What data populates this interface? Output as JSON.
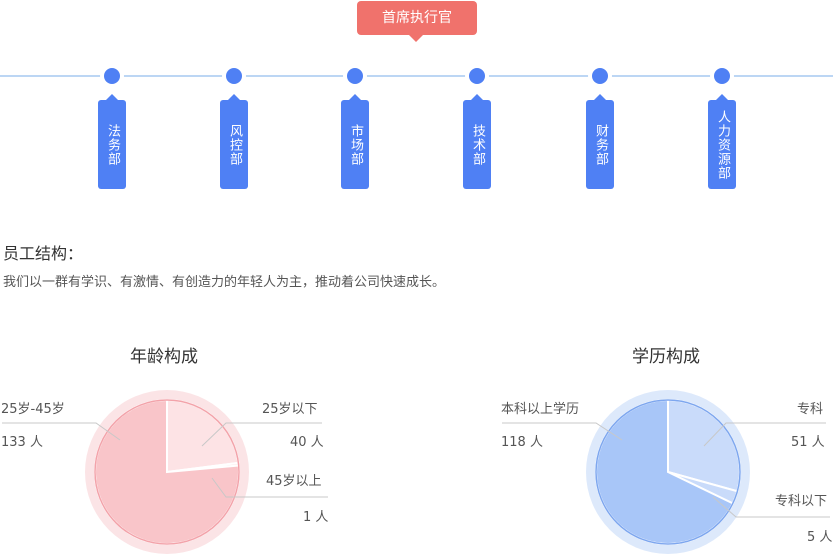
{
  "org": {
    "ceo_label": "首席执行官",
    "departments": [
      {
        "name": "法务部"
      },
      {
        "name": "风控部"
      },
      {
        "name": "市场部"
      },
      {
        "name": "技术部"
      },
      {
        "name": "财务部"
      },
      {
        "name": "人力资源部"
      }
    ]
  },
  "structure": {
    "title": "员工结构：",
    "description": "我们以一群有学识、有激情、有创造力的年轻人为主，推动着公司快速成长。"
  },
  "charts": {
    "age": {
      "title": "年龄构成",
      "slices": [
        {
          "label": "25岁以下",
          "count": "40 人",
          "value": 40
        },
        {
          "label": "45岁以上",
          "count": "1 人",
          "value": 1
        },
        {
          "label": "25岁-45岁",
          "count": "133 人",
          "value": 133
        }
      ],
      "colors": {
        "ring": "#fbe4e6",
        "main": "#f9c5c9",
        "light": "#fde3e5",
        "edge": "#f3a3aa"
      }
    },
    "education": {
      "title": "学历构成",
      "slices": [
        {
          "label": "专科",
          "count": "51 人",
          "value": 51
        },
        {
          "label": "专科以下",
          "count": "5 人",
          "value": 5
        },
        {
          "label": "本科以上学历",
          "count": "118 人",
          "value": 118
        }
      ],
      "colors": {
        "ring": "#dde9fb",
        "main": "#a8c6f8",
        "light": "#c9dbfa",
        "edge": "#7ea7ef"
      }
    }
  }
}
